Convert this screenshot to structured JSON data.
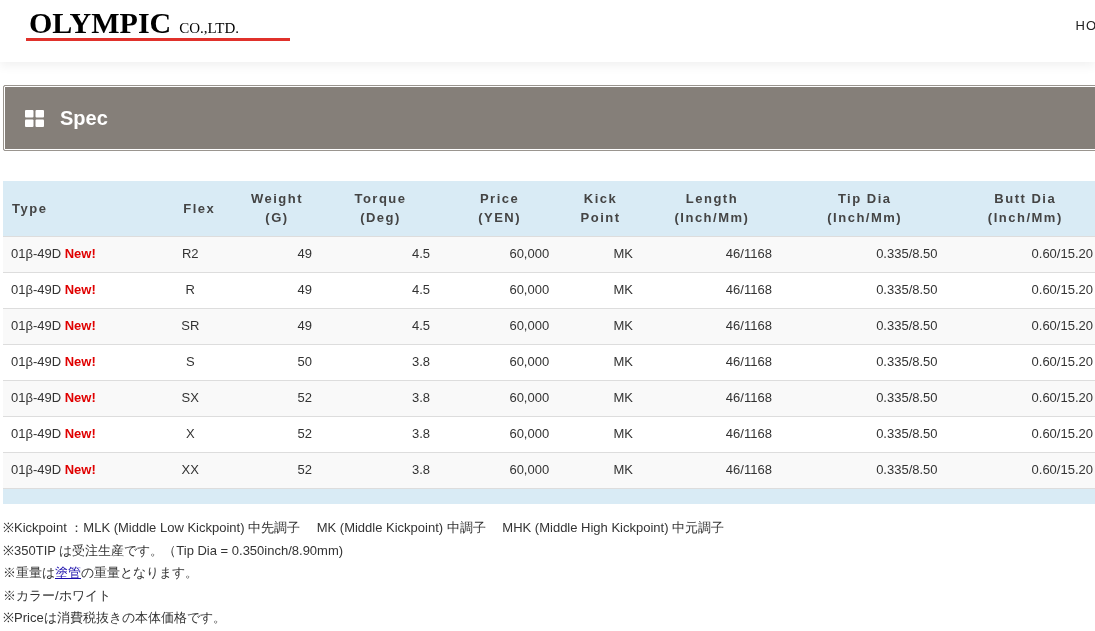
{
  "header": {
    "logo": "OLYMPIC",
    "logo_suffix": "CO.,LTD.",
    "nav": [
      "HO"
    ]
  },
  "panel": {
    "title": "Spec"
  },
  "table": {
    "columns": [
      "Type",
      "Flex",
      "Weight\n(G)",
      "Torque\n(Deg)",
      "Price\n(YEN)",
      "Kick\nPoint",
      "Length\n(Inch/Mm)",
      "Tip Dia\n(Inch/Mm)",
      "Butt Dia\n(Inch/Mm)"
    ],
    "rows": [
      {
        "badge": "New!",
        "cells": [
          "01β-49D",
          "R2",
          "49",
          "4.5",
          "60,000",
          "MK",
          "46/1168",
          "0.335/8.50",
          "0.60/15.20"
        ]
      },
      {
        "badge": "New!",
        "cells": [
          "01β-49D",
          "R",
          "49",
          "4.5",
          "60,000",
          "MK",
          "46/1168",
          "0.335/8.50",
          "0.60/15.20"
        ]
      },
      {
        "badge": "New!",
        "cells": [
          "01β-49D",
          "SR",
          "49",
          "4.5",
          "60,000",
          "MK",
          "46/1168",
          "0.335/8.50",
          "0.60/15.20"
        ]
      },
      {
        "badge": "New!",
        "cells": [
          "01β-49D",
          "S",
          "50",
          "3.8",
          "60,000",
          "MK",
          "46/1168",
          "0.335/8.50",
          "0.60/15.20"
        ]
      },
      {
        "badge": "New!",
        "cells": [
          "01β-49D",
          "SX",
          "52",
          "3.8",
          "60,000",
          "MK",
          "46/1168",
          "0.335/8.50",
          "0.60/15.20"
        ]
      },
      {
        "badge": "New!",
        "cells": [
          "01β-49D",
          "X",
          "52",
          "3.8",
          "60,000",
          "MK",
          "46/1168",
          "0.335/8.50",
          "0.60/15.20"
        ]
      },
      {
        "badge": "New!",
        "cells": [
          "01β-49D",
          "XX",
          "52",
          "3.8",
          "60,000",
          "MK",
          "46/1168",
          "0.335/8.50",
          "0.60/15.20"
        ]
      }
    ]
  },
  "notes": [
    {
      "kind": "text",
      "text": "※Kickpoint ：MLK (Middle Low Kickpoint) 中先調子　 MK (Middle Kickpoint) 中調子　 MHK (Middle High Kickpoint) 中元調子"
    },
    {
      "kind": "text",
      "text": "※350TIP は受注生産です。（Tip Dia = 0.350inch/8.90mm)"
    },
    {
      "kind": "link",
      "before": "※重量は",
      "link": "塗管",
      "after": "の重量となります。"
    },
    {
      "kind": "text",
      "text": "※カラー/ホワイト"
    },
    {
      "kind": "text",
      "text": "※Priceは消費税抜きの本体価格です。"
    }
  ]
}
